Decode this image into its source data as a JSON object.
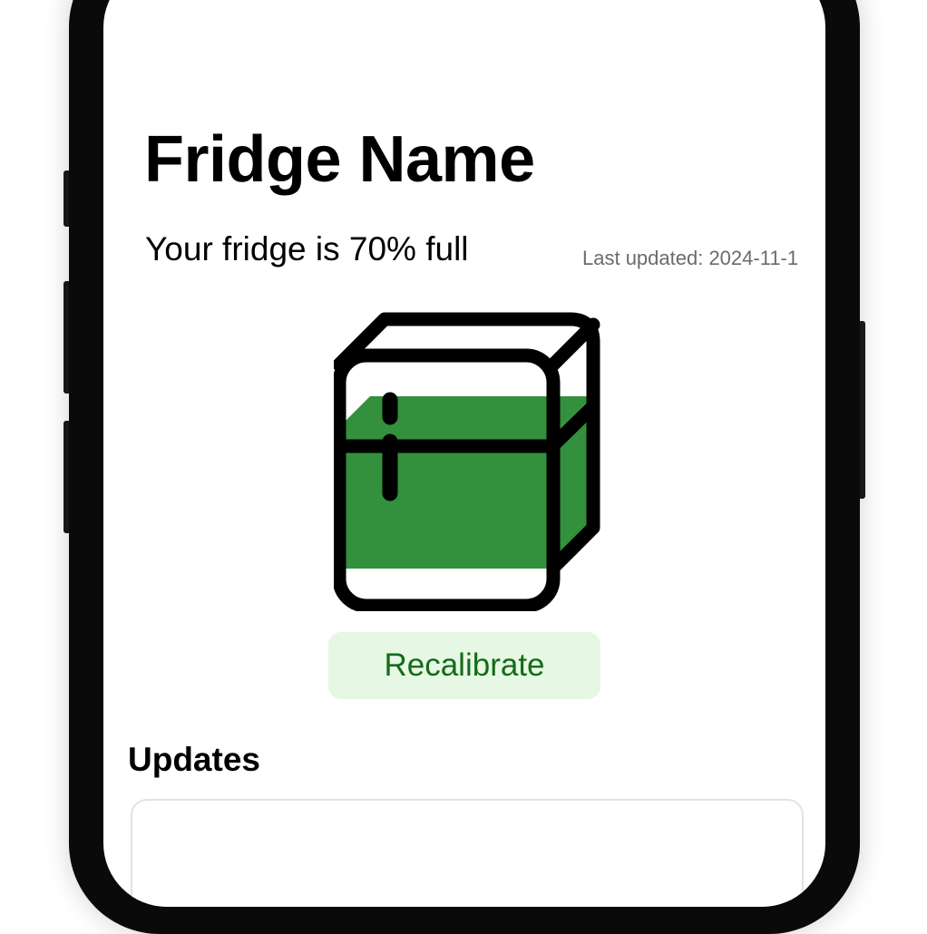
{
  "header": {
    "title": "Fridge Name"
  },
  "status": {
    "fill_text": "Your fridge is 70% full",
    "fill_fraction": 0.7,
    "last_updated": "Last updated: 2024-11-1"
  },
  "fridge": {
    "icon": "fridge-icon",
    "fill_color": "#33903c",
    "outline_color": "#000000"
  },
  "actions": {
    "recalibrate_label": "Recalibrate",
    "recalibrate_bg": "#e6f7e3",
    "recalibrate_text_color": "#146b1a"
  },
  "updates": {
    "section_title": "Updates"
  }
}
